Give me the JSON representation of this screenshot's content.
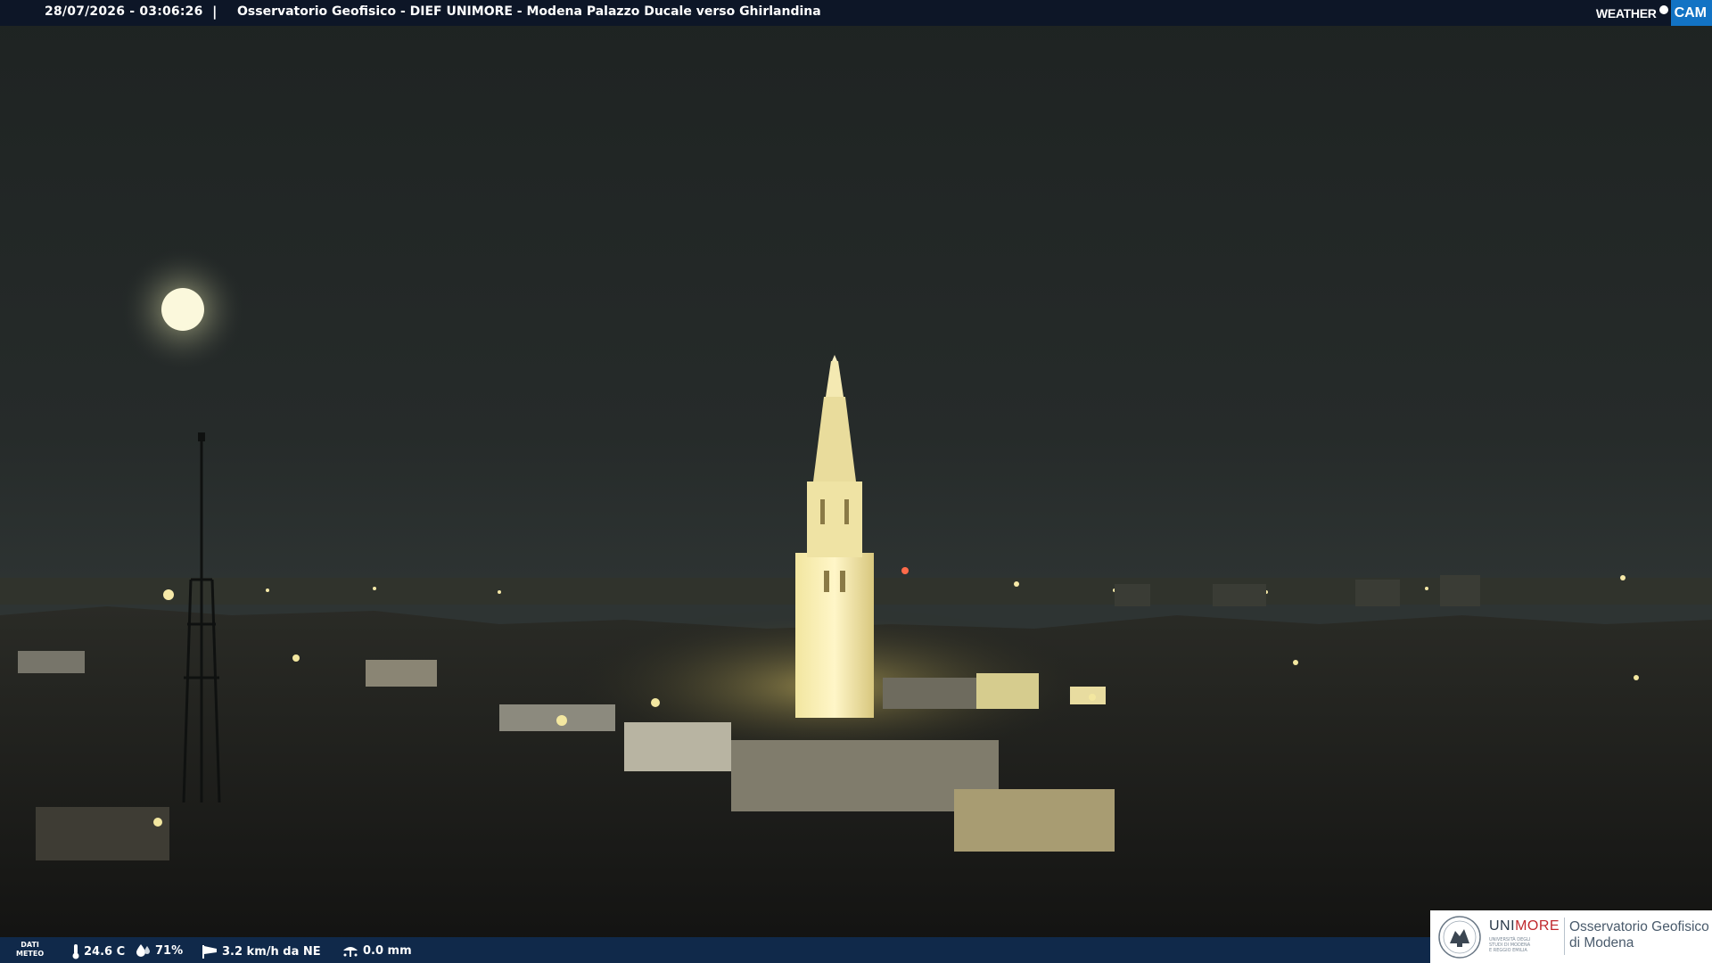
{
  "header": {
    "timestamp": "28/07/2026 - 03:06:26",
    "separator": "|",
    "caption": "Osservatorio Geofisico - DIEF UNIMORE - Modena Palazzo Ducale verso Ghirlandina"
  },
  "brand": {
    "weather": "WEATHER",
    "cam": "CAM",
    "colors": {
      "cam_bg": "#1273c4"
    }
  },
  "meteo": {
    "label_line1": "DATI",
    "label_line2": "METEO",
    "temperature": "24.6 C",
    "humidity": "71%",
    "wind": "3.2 km/h da NE",
    "rain": "0.0 mm",
    "icons": [
      "thermometer-icon",
      "humidity-drop-icon",
      "wind-sock-icon",
      "rain-gauge-icon"
    ]
  },
  "logo": {
    "uni_part1": "UNI",
    "uni_part2": "MORE",
    "uni_subtitle": "UNIVERSITÀ DEGLI STUDI DI MODENA E REGGIO EMILIA",
    "obs_line1": "Osservatorio Geofisico",
    "obs_line2": "di Modena",
    "colors": {
      "uni": "#2b3a4a",
      "more": "#c0282d"
    }
  }
}
